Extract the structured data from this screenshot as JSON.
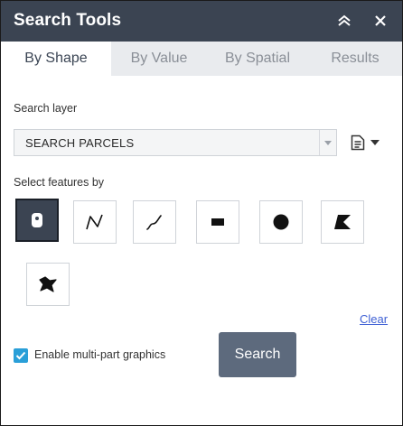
{
  "window": {
    "title": "Search Tools",
    "collapse_icon": "double-chevron-up-icon",
    "close_icon": "close-icon"
  },
  "tabs": [
    {
      "label": "By Shape",
      "active": true
    },
    {
      "label": "By Value",
      "active": false
    },
    {
      "label": "By Spatial",
      "active": false
    },
    {
      "label": "Results",
      "active": false
    }
  ],
  "search_layer": {
    "label": "Search layer",
    "selected": "SEARCH PARCELS",
    "menu_icon": "document-list-icon"
  },
  "select_features": {
    "label": "Select features by",
    "tools": [
      {
        "name": "point",
        "icon": "point-marker-icon",
        "active": true
      },
      {
        "name": "polyline",
        "icon": "polyline-icon",
        "active": false
      },
      {
        "name": "freehand-polyline",
        "icon": "freehand-line-icon",
        "active": false
      },
      {
        "name": "rectangle",
        "icon": "rectangle-icon",
        "active": false
      },
      {
        "name": "circle",
        "icon": "circle-icon",
        "active": false
      },
      {
        "name": "polygon",
        "icon": "polygon-icon",
        "active": false
      },
      {
        "name": "freehand-polygon",
        "icon": "freehand-polygon-icon",
        "active": false
      }
    ]
  },
  "actions": {
    "clear_label": "Clear",
    "multipart_label": "Enable multi-part graphics",
    "multipart_checked": true,
    "search_label": "Search"
  },
  "colors": {
    "header_bg": "#3b4452",
    "checkbox": "#2a9fd8",
    "search_button": "#5d6a7d",
    "link": "#3d5fd4"
  }
}
